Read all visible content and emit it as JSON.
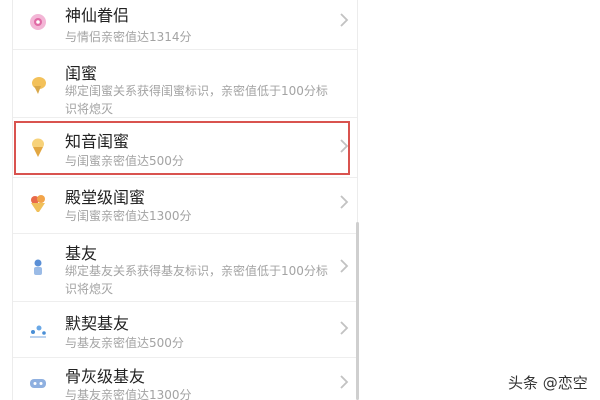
{
  "list": {
    "items": [
      {
        "title": "神仙眷侣",
        "desc": "与情侣亲密值达1314分",
        "icon": "flower-badge-icon"
      },
      {
        "title": "闺蜜",
        "desc": "绑定闺蜜关系获得闺蜜标识，亲密值低于100分标识将熄灭",
        "icon": "ice-cream-icon"
      },
      {
        "title": "知音闺蜜",
        "desc": "与闺蜜亲密值达500分",
        "icon": "ice-cream-cone-icon"
      },
      {
        "title": "殿堂级闺蜜",
        "desc": "与闺蜜亲密值达1300分",
        "icon": "sundae-icon"
      },
      {
        "title": "基友",
        "desc": "绑定基友关系获得基友标识，亲密值低于100分标识将熄灭",
        "icon": "figure-badge-icon"
      },
      {
        "title": "默契基友",
        "desc": "与基友亲密值达500分",
        "icon": "stars-badge-icon"
      },
      {
        "title": "骨灰级基友",
        "desc": "与基友亲密值达1300分",
        "icon": "gamepad-icon"
      }
    ]
  },
  "watermark": {
    "text": "头条 @恋空"
  },
  "colors": {
    "highlight": "#d9534f",
    "title": "#222222",
    "description": "#a3a3a3"
  }
}
